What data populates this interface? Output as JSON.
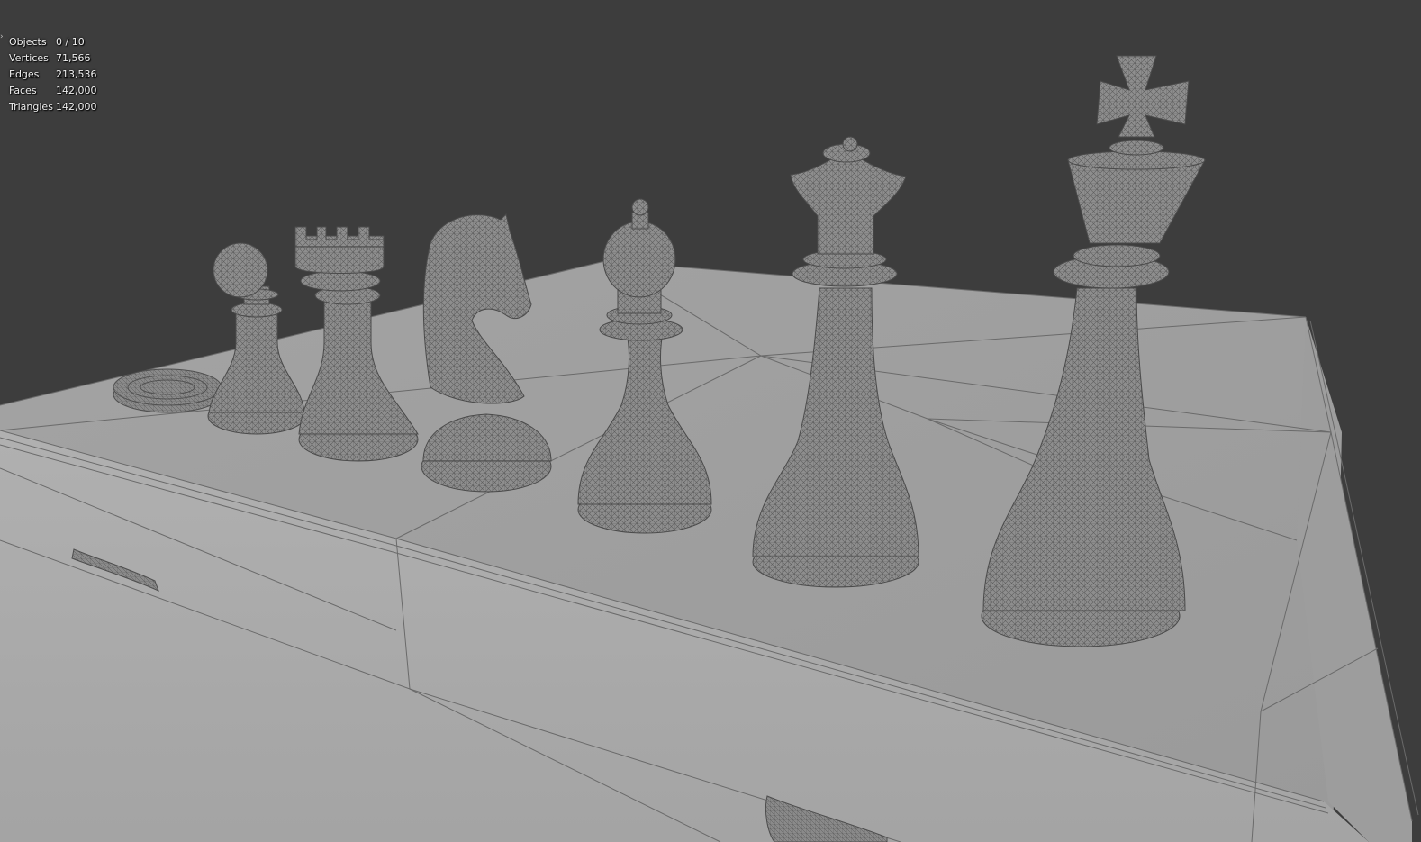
{
  "viewport": {
    "background": "#3d3d3d",
    "wire_color": "#575757",
    "solid_color": "#8c8c8c",
    "mode": "solid-wireframe overlay"
  },
  "overlay_toggle_icon": "chevron-right-icon",
  "statistics": [
    {
      "label": "Objects",
      "value": "0 / 10"
    },
    {
      "label": "Vertices",
      "value": "71,566"
    },
    {
      "label": "Edges",
      "value": "213,536"
    },
    {
      "label": "Faces",
      "value": "142,000"
    },
    {
      "label": "Triangles",
      "value": "142,000"
    }
  ],
  "scene_objects": [
    "checker-disc",
    "pawn",
    "rook",
    "knight",
    "bishop",
    "queen",
    "king",
    "board",
    "board-handle-left",
    "board-handle-front"
  ]
}
